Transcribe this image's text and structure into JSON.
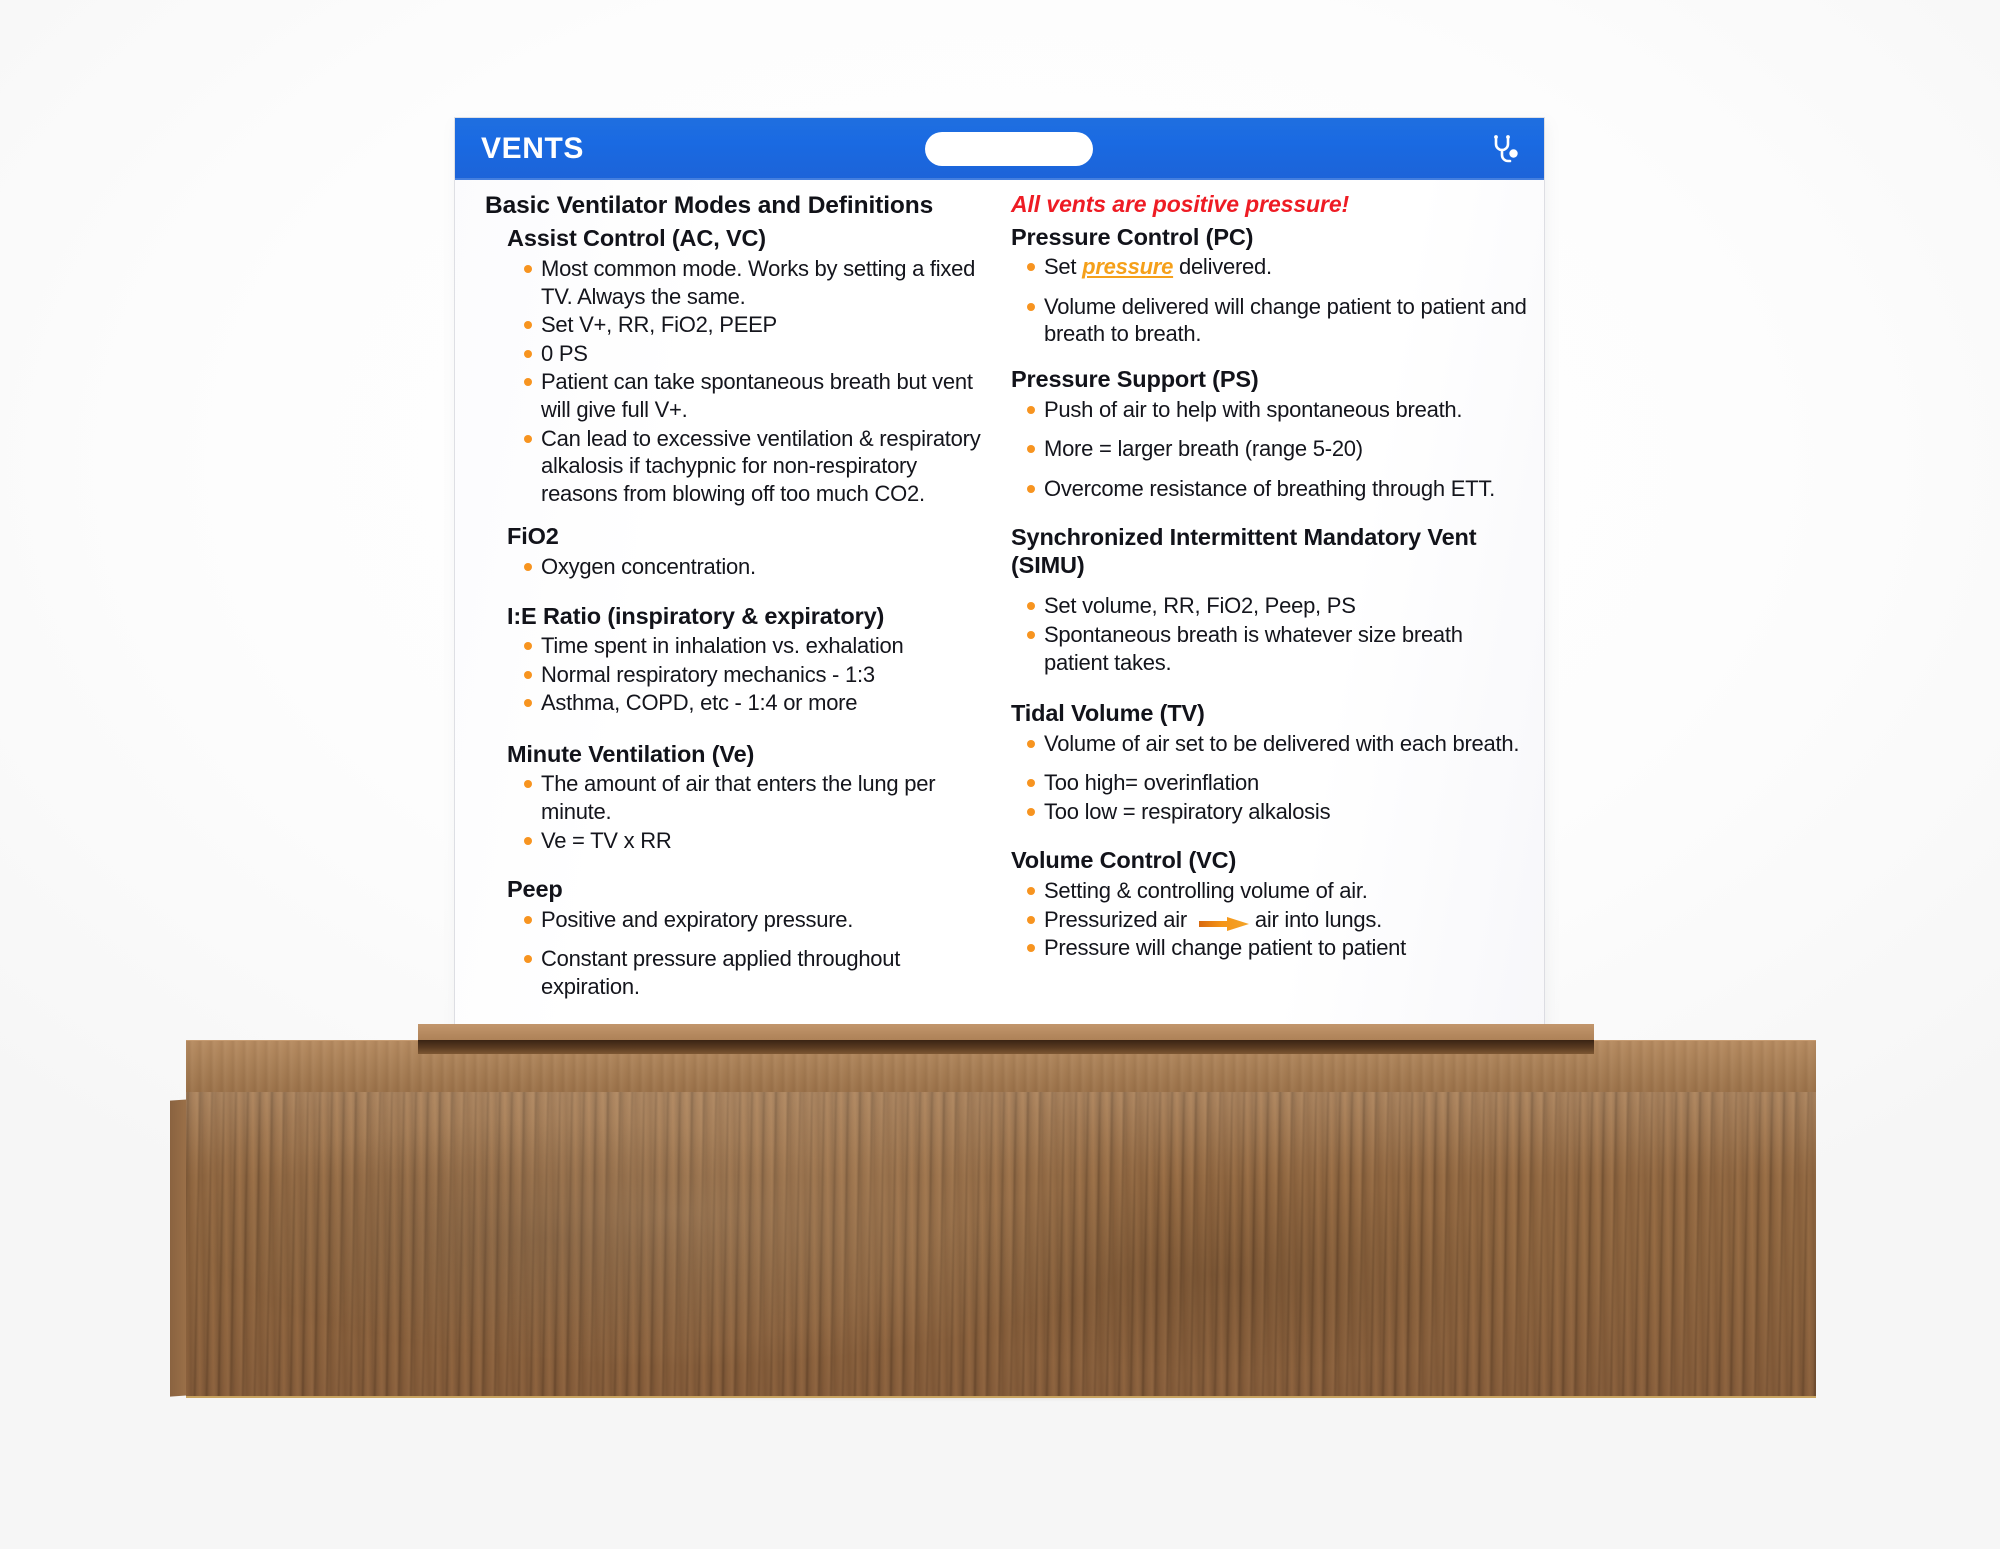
{
  "scene": {
    "object": "laminated medical reference badge card in a wooden display block",
    "background_color": "#ffffff"
  },
  "card": {
    "header": {
      "title": "VENTS",
      "header_color": "#1a6ae2",
      "title_color": "#ffffff",
      "badge_slot": "badge-punch-slot",
      "icon": "stethoscope-icon"
    },
    "accent_colors": {
      "bullet": "#f79420",
      "alert_text": "#ee1c24",
      "highlight": "#f5a01a",
      "heading": "#12131a"
    },
    "left_column": {
      "title": "Basic Ventilator Modes and Definitions",
      "sections": [
        {
          "heading": "Assist Control (AC, VC)",
          "indent": "deep",
          "bullets": [
            "Most common mode. Works by setting a fixed TV.  Always the same.",
            "Set V+, RR, FiO2, PEEP",
            "0 PS",
            "Patient can take spontaneous breath but vent will give full V+.",
            "Can lead to excessive ventilation & respiratory alkalosis if tachypnic for non-respiratory reasons from blowing off too much CO2."
          ]
        },
        {
          "heading": "FiO2",
          "indent": "normal",
          "bullets": [
            "Oxygen concentration."
          ]
        },
        {
          "heading": "I:E Ratio (inspiratory & expiratory)",
          "indent": "normal",
          "bullets": [
            "Time spent in inhalation vs. exhalation",
            "Normal respiratory mechanics - 1:3",
            "Asthma, COPD, etc - 1:4 or more"
          ]
        },
        {
          "heading": "Minute Ventilation (Ve)",
          "indent": "normal",
          "bullets": [
            "The amount of air that enters the lung per minute.",
            "Ve = TV x RR"
          ]
        },
        {
          "heading": "Peep",
          "indent": "normal",
          "bullets": [
            "Positive and expiratory pressure.",
            "Constant pressure applied throughout expiration."
          ]
        }
      ]
    },
    "right_column": {
      "alert": "All vents are positive pressure!",
      "sections": [
        {
          "heading": "Pressure Control (PC)",
          "bullets_rich": [
            {
              "pre": "Set ",
              "highlight": "pressure",
              "post": " delivered."
            },
            {
              "pre": "Volume delivered will change patient to patient and breath to breath.",
              "highlight": "",
              "post": ""
            }
          ]
        },
        {
          "heading": "Pressure Support  (PS)",
          "bullets": [
            "Push of air to help with spontaneous breath.",
            "More = larger breath (range 5-20)",
            "Overcome resistance of breathing through ETT."
          ]
        },
        {
          "heading": "Synchronized Intermittent Mandatory Vent (SIMU)",
          "bullets": [
            "Set volume, RR, FiO2, Peep, PS",
            "Spontaneous breath is whatever size breath patient takes."
          ]
        },
        {
          "heading": "Tidal Volume (TV)",
          "bullets": [
            "Volume of air set to be delivered with each breath.",
            "Too high= overinflation",
            "Too low = respiratory alkalosis"
          ]
        },
        {
          "heading": "Volume Control (VC)",
          "bullets_arrow": [
            {
              "text": "Setting & controlling volume of air.",
              "arrow": false
            },
            {
              "pre": "Pressurized air ",
              "arrow": true,
              "post": "air into lungs."
            },
            {
              "text": "Pressure will change patient to patient",
              "arrow": false
            }
          ]
        }
      ]
    }
  },
  "stand": {
    "material": "walnut wood block",
    "wood_color": "#9d7249",
    "slot_color": "#4a2f18"
  }
}
